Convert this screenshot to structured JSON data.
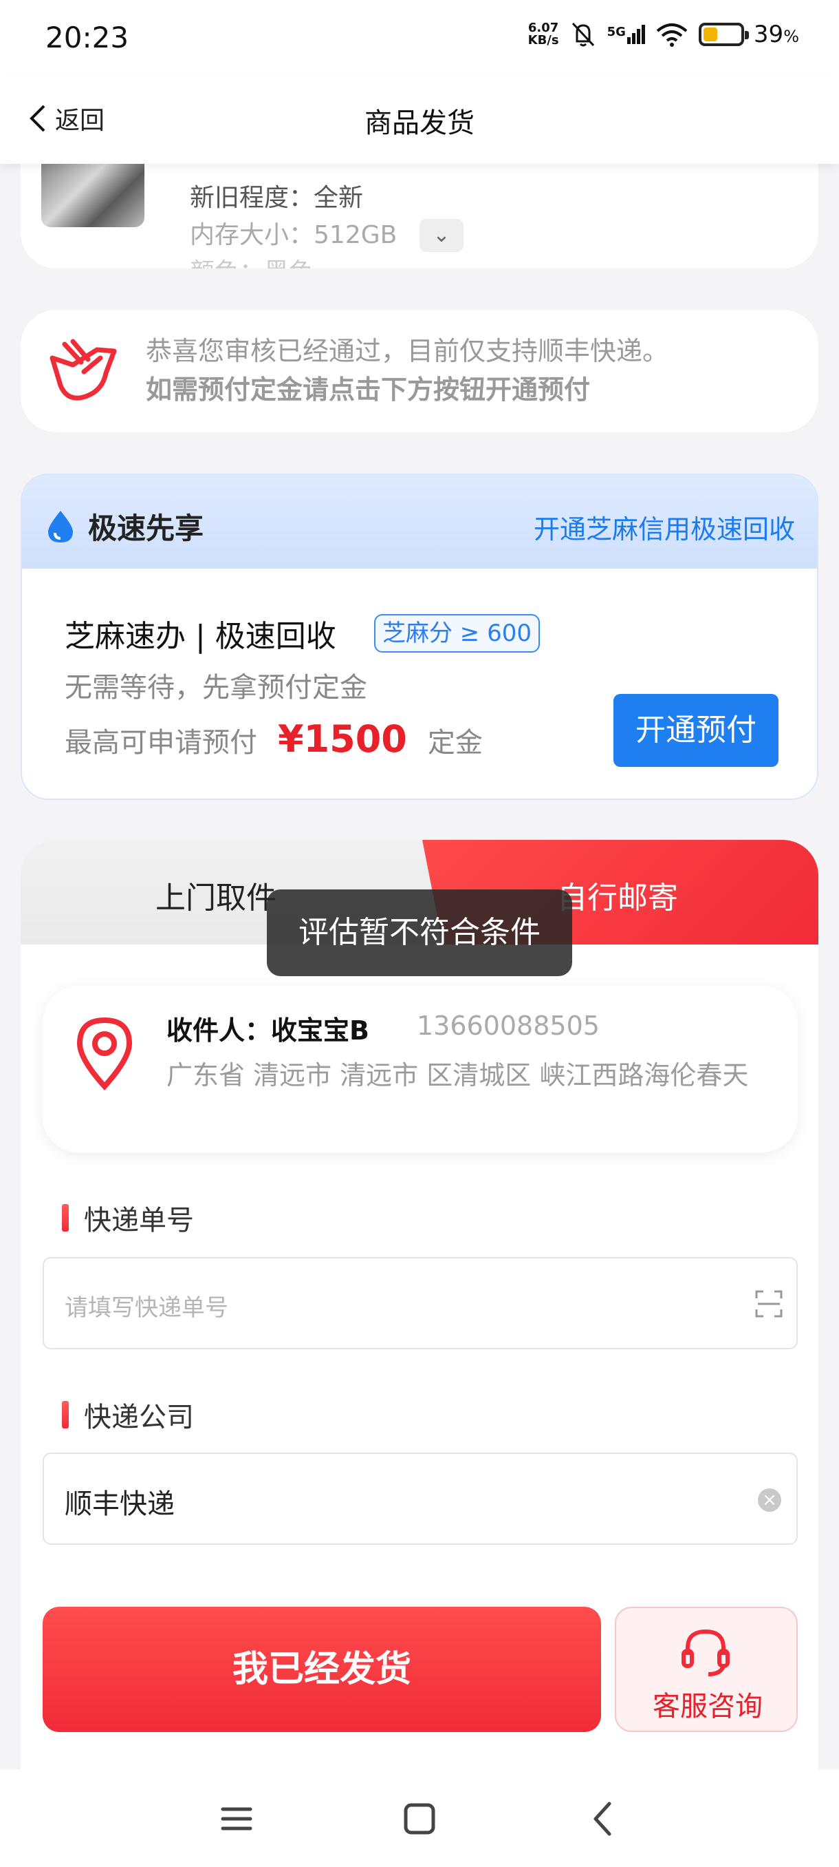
{
  "status_bar": {
    "time": "20:23",
    "net_speed": "6.07",
    "net_unit": "KB/s",
    "network": "5G",
    "battery": "39",
    "battery_unit": "%",
    "battery_level": 0.39
  },
  "header": {
    "back_label": "返回",
    "title": "商品发货"
  },
  "product": {
    "condition_label": "新旧程度：",
    "condition_value": "全新",
    "memory_label": "内存大小：",
    "memory_value": "512GB",
    "color_label": "颜色：",
    "color_value": "黑色"
  },
  "notice": {
    "line1": "恭喜您审核已经通过，目前仅支持顺丰快递。",
    "line2": "如需预付定金请点击下方按钮开通预付"
  },
  "fast": {
    "title": "极速先享",
    "link": "开通芝麻信用极速回收",
    "main": "芝麻速办 | 极速回收",
    "badge": "芝麻分 ≥ 600",
    "sub": "无需等待，先拿预付定金",
    "max_prefix": "最高可申请预付",
    "amount": "¥1500",
    "max_suffix": "定金",
    "open_button": "开通预付"
  },
  "tabs": {
    "pickup": "上门取件",
    "self_mail": "自行邮寄"
  },
  "toast": "评估暂不符合条件",
  "address": {
    "name": "收件人：收宝宝B",
    "phone": "13660088505",
    "detail": "广东省 清远市 清远市 区清城区 峡江西路海伦春天"
  },
  "tracking": {
    "label": "快递单号",
    "placeholder": "请填写快递单号"
  },
  "courier": {
    "label": "快递公司",
    "value": "顺丰快递"
  },
  "actions": {
    "shipped": "我已经发货",
    "service": "客服咨询"
  },
  "colors": {
    "accent_red": "#f02c38",
    "accent_blue": "#1f7ff0"
  }
}
